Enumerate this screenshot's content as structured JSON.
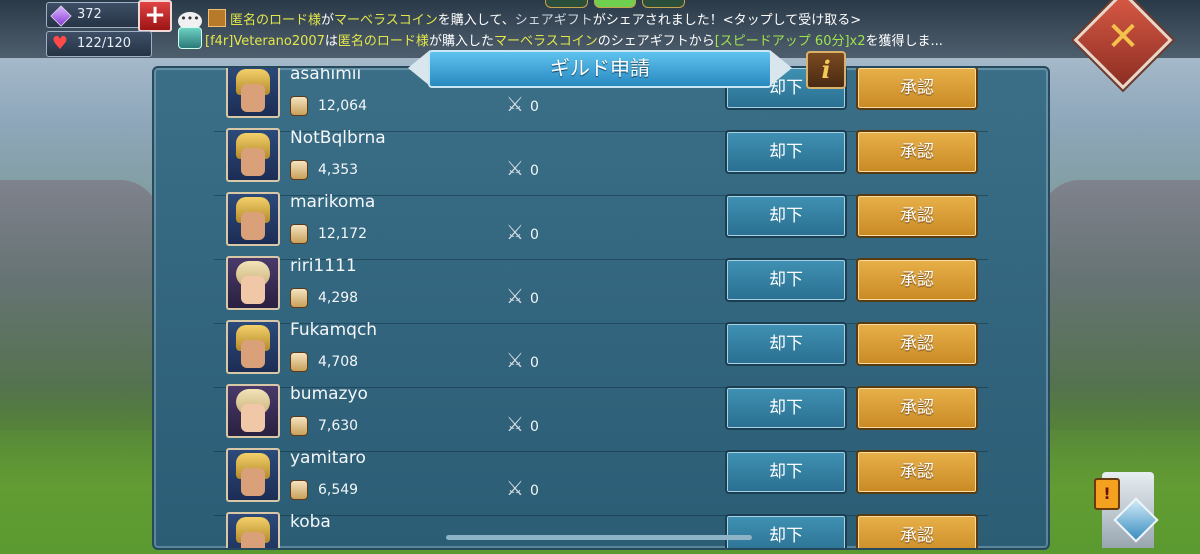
{
  "resources": {
    "gems": "372",
    "stamina": "122/120",
    "plus_icon": "plus-icon",
    "colors": {
      "gem": "#8b3bd6",
      "heart": "#ff4a4a",
      "plus": "#e04343"
    }
  },
  "ticker": {
    "line1": {
      "a": "匿名のロード様",
      "b": "が",
      "c": "マーベラスコイン",
      "d": "を購入して、",
      "e": "シェアギフト",
      "f": "がシェアされました！<タップして受け取る>"
    },
    "line2": {
      "a": "[f4r]Veterano2007",
      "b": "は",
      "c": "匿名のロード様",
      "d": "が購入した",
      "e": "マーベラスコイン",
      "f": "のシェアギフトから",
      "g": "[スピードアップ 60分]x2",
      "h": "を獲得しま..."
    }
  },
  "panel": {
    "title": "ギルド申請",
    "info_label": "i",
    "reject_label": "却下",
    "accept_label": "承認",
    "colors": {
      "accept": "#e8b04a",
      "reject": "#3f91b3",
      "panel": "#2b5d75"
    }
  },
  "applicants": [
    {
      "name": "asahimii",
      "power": "12,064",
      "kills": "0",
      "avatar": "knight"
    },
    {
      "name": "NotBqlbrna",
      "power": "4,353",
      "kills": "0",
      "avatar": "knight"
    },
    {
      "name": "marikoma",
      "power": "12,172",
      "kills": "0",
      "avatar": "knight"
    },
    {
      "name": "riri1111",
      "power": "4,298",
      "kills": "0",
      "avatar": "girl"
    },
    {
      "name": "Fukamqch",
      "power": "4,708",
      "kills": "0",
      "avatar": "knight"
    },
    {
      "name": "bumazyo",
      "power": "7,630",
      "kills": "0",
      "avatar": "girl"
    },
    {
      "name": "yamitaro",
      "power": "6,549",
      "kills": "0",
      "avatar": "knight"
    },
    {
      "name": "koba",
      "power": "",
      "kills": "",
      "avatar": "knight"
    }
  ],
  "close_icon": "close-icon"
}
